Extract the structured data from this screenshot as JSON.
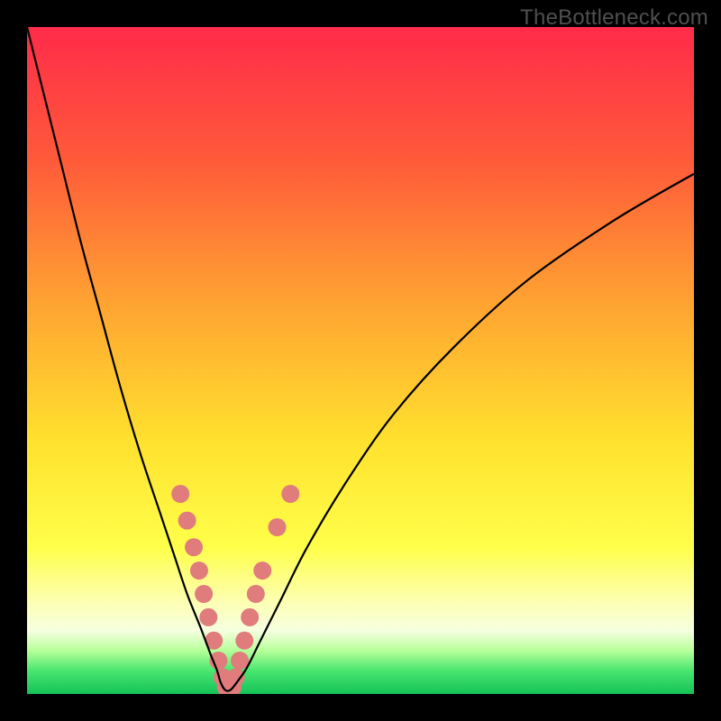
{
  "watermark": {
    "text": "TheBottleneck.com"
  },
  "chart_data": {
    "type": "line",
    "title": "",
    "xlabel": "",
    "ylabel": "",
    "xlim": [
      0,
      100
    ],
    "ylim": [
      0,
      100
    ],
    "grid": false,
    "legend": false,
    "background_gradient_stops": [
      {
        "offset": 0.0,
        "color": "#ff2b4a"
      },
      {
        "offset": 0.2,
        "color": "#ff5a3a"
      },
      {
        "offset": 0.42,
        "color": "#ffa531"
      },
      {
        "offset": 0.62,
        "color": "#ffe12e"
      },
      {
        "offset": 0.78,
        "color": "#ffff4a"
      },
      {
        "offset": 0.86,
        "color": "#fdffb0"
      },
      {
        "offset": 0.905,
        "color": "#f6ffe0"
      },
      {
        "offset": 0.935,
        "color": "#b7ff9a"
      },
      {
        "offset": 0.965,
        "color": "#49e66f"
      },
      {
        "offset": 1.0,
        "color": "#15c257"
      }
    ],
    "series": [
      {
        "name": "bottleneck-curve",
        "color": "#000000",
        "x": [
          0,
          2,
          5,
          8,
          11,
          14,
          17,
          20,
          22,
          24,
          26,
          27.5,
          28.5,
          29,
          29.7,
          30.5,
          31.5,
          33,
          35,
          38,
          42,
          48,
          55,
          64,
          75,
          88,
          100
        ],
        "y": [
          100,
          92,
          80,
          68,
          57,
          46,
          36,
          27,
          21,
          15,
          10,
          6,
          3.5,
          1.8,
          0.6,
          0.6,
          1.8,
          4,
          8,
          14,
          22,
          32,
          42,
          52,
          62,
          71,
          78
        ]
      }
    ],
    "markers": {
      "name": "highlight-dots",
      "color": "#e07c7c",
      "radius": 10,
      "points": [
        {
          "x": 23.0,
          "y": 30.0
        },
        {
          "x": 24.0,
          "y": 26.0
        },
        {
          "x": 25.0,
          "y": 22.0
        },
        {
          "x": 25.8,
          "y": 18.5
        },
        {
          "x": 26.5,
          "y": 15.0
        },
        {
          "x": 27.2,
          "y": 11.5
        },
        {
          "x": 28.0,
          "y": 8.0
        },
        {
          "x": 28.7,
          "y": 5.0
        },
        {
          "x": 29.3,
          "y": 2.5
        },
        {
          "x": 29.8,
          "y": 1.0
        },
        {
          "x": 30.3,
          "y": 1.0
        },
        {
          "x": 30.8,
          "y": 1.0
        },
        {
          "x": 31.3,
          "y": 2.5
        },
        {
          "x": 31.9,
          "y": 5.0
        },
        {
          "x": 32.6,
          "y": 8.0
        },
        {
          "x": 33.4,
          "y": 11.5
        },
        {
          "x": 34.3,
          "y": 15.0
        },
        {
          "x": 35.3,
          "y": 18.5
        },
        {
          "x": 37.5,
          "y": 25.0
        },
        {
          "x": 39.5,
          "y": 30.0
        }
      ]
    }
  }
}
